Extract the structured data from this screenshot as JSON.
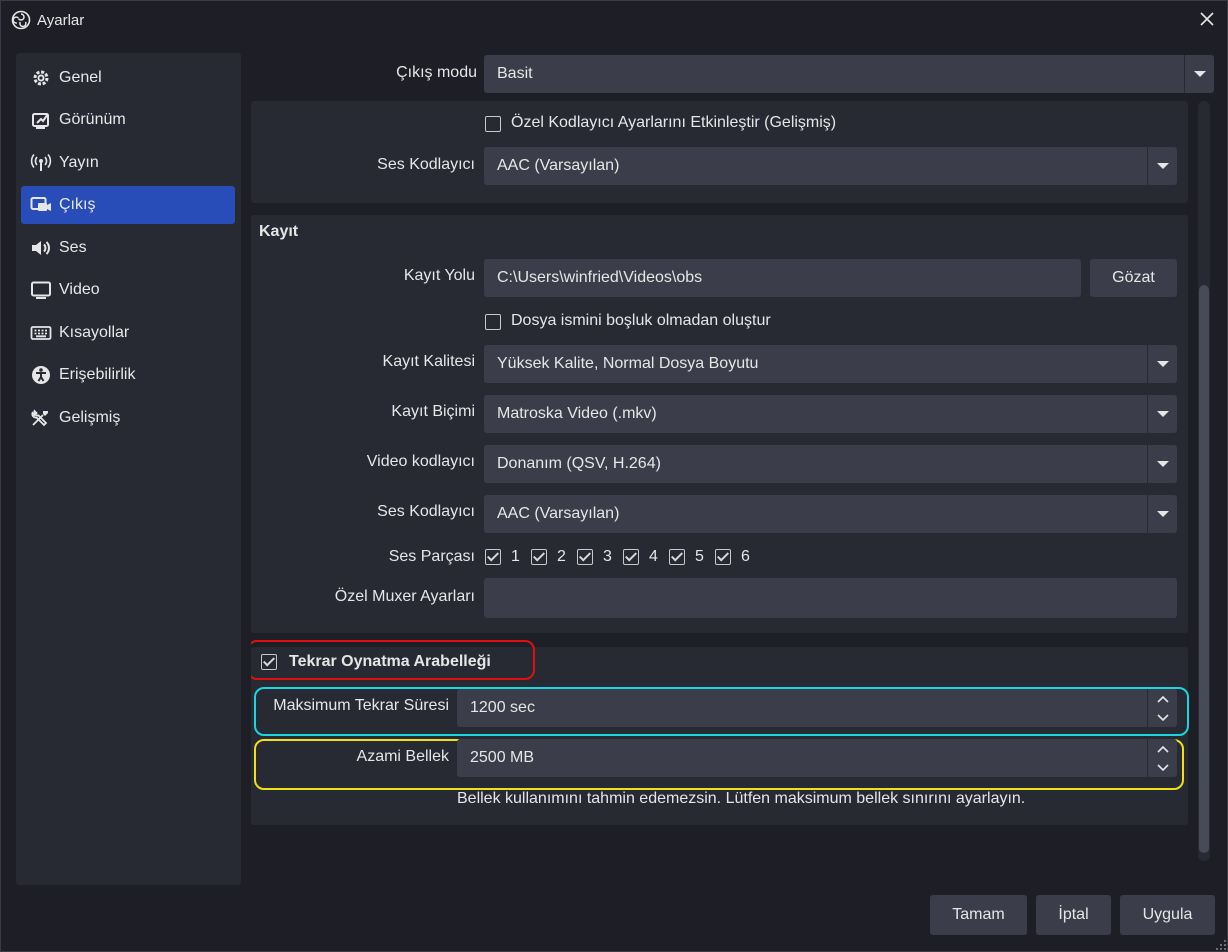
{
  "window": {
    "title": "Ayarlar"
  },
  "sidebar": {
    "items": [
      {
        "label": "Genel",
        "icon": "gear-icon"
      },
      {
        "label": "Görünüm",
        "icon": "appearance-icon"
      },
      {
        "label": "Yayın",
        "icon": "broadcast-icon"
      },
      {
        "label": "Çıkış",
        "icon": "output-icon",
        "active": true
      },
      {
        "label": "Ses",
        "icon": "speaker-icon"
      },
      {
        "label": "Video",
        "icon": "monitor-icon"
      },
      {
        "label": "Kısayollar",
        "icon": "keyboard-icon"
      },
      {
        "label": "Erişebilirlik",
        "icon": "accessibility-icon"
      },
      {
        "label": "Gelişmiş",
        "icon": "tools-icon"
      }
    ]
  },
  "output_mode": {
    "label": "Çıkış modu",
    "value": "Basit"
  },
  "streaming": {
    "custom_encoder_label": "Özel Kodlayıcı Ayarlarını Etkinleştir (Gelişmiş)",
    "custom_encoder_checked": false,
    "audio_encoder_label": "Ses Kodlayıcı",
    "audio_encoder_value": "AAC (Varsayılan)"
  },
  "recording": {
    "heading": "Kayıt",
    "path_label": "Kayıt Yolu",
    "path_value": "C:\\Users\\winfried\\Videos\\obs",
    "browse_label": "Gözat",
    "no_space_label": "Dosya ismini boşluk olmadan oluştur",
    "no_space_checked": false,
    "quality_label": "Kayıt Kalitesi",
    "quality_value": "Yüksek Kalite, Normal Dosya Boyutu",
    "format_label": "Kayıt Biçimi",
    "format_value": "Matroska Video (.mkv)",
    "video_encoder_label": "Video kodlayıcı",
    "video_encoder_value": "Donanım (QSV, H.264)",
    "audio_encoder_label": "Ses Kodlayıcı",
    "audio_encoder_value": "AAC (Varsayılan)",
    "audio_track_label": "Ses Parçası",
    "audio_tracks": [
      "1",
      "2",
      "3",
      "4",
      "5",
      "6"
    ],
    "muxer_label": "Özel Muxer Ayarları",
    "muxer_value": ""
  },
  "replay_buffer": {
    "label": "Tekrar Oynatma Arabelleği",
    "checked": true,
    "max_time_label": "Maksimum Tekrar Süresi",
    "max_time_value": "1200 sec",
    "max_memory_label": "Azami Bellek",
    "max_memory_value": "2500 MB",
    "warning": "Bellek kullanımını tahmin edemezsin. Lütfen maksimum bellek sınırını ayarlayın."
  },
  "footer": {
    "ok": "Tamam",
    "cancel": "İptal",
    "apply": "Uygula"
  },
  "colors": {
    "accent": "#284cb8",
    "highlight_red": "#e01010",
    "highlight_cyan": "#19d6e0",
    "highlight_yellow": "#f0e01a"
  }
}
